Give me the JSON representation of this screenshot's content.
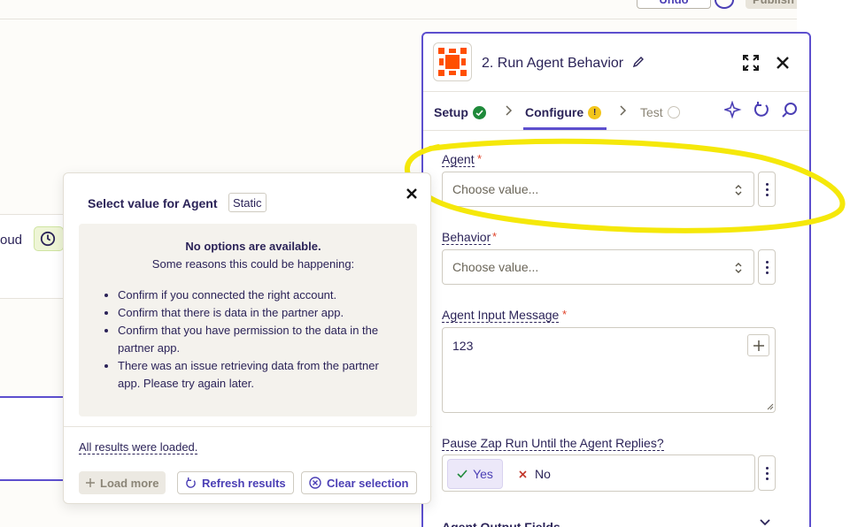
{
  "topbar": {
    "undo_label": "Undo",
    "publish_label": "Publish"
  },
  "canvas": {
    "node_text": "oud"
  },
  "panel": {
    "title": "2. Run Agent Behavior",
    "tabs": [
      {
        "label": "Setup",
        "status": "complete"
      },
      {
        "label": "Configure",
        "status": "warning"
      },
      {
        "label": "Test",
        "status": "pending"
      }
    ],
    "fields": {
      "agent": {
        "label": "Agent",
        "required_mark": "*",
        "placeholder": "Choose value..."
      },
      "behavior": {
        "label": "Behavior",
        "required_mark": "*",
        "placeholder": "Choose value..."
      },
      "input_message": {
        "label": "Agent Input Message",
        "required_mark": "*",
        "value": "123"
      },
      "pause": {
        "label": "Pause Zap Run Until the Agent Replies?",
        "yes_label": "Yes",
        "no_label": "No",
        "selected": "Yes"
      }
    },
    "section_output": "Agent Output Fields"
  },
  "popover": {
    "title": "Select value for Agent",
    "badge": "Static",
    "heading": "No options are available.",
    "subheading": "Some reasons this could be happening:",
    "reasons": [
      "Confirm if you connected the right account.",
      "Confirm that there is data in the partner app.",
      "Confirm that you have permission to the data in the partner app.",
      "There was an issue retrieving data from the partner app. Please try again later."
    ],
    "loaded_text": "All results were loaded.",
    "load_more": "Load more",
    "refresh": "Refresh results",
    "clear": "Clear selection"
  },
  "colors": {
    "accent": "#5d4fce",
    "highlight": "#f5e80a",
    "required": "#e0442b",
    "success": "#1f8a3a",
    "warning": "#f2c51b",
    "brand_orange": "#ff4f00"
  }
}
